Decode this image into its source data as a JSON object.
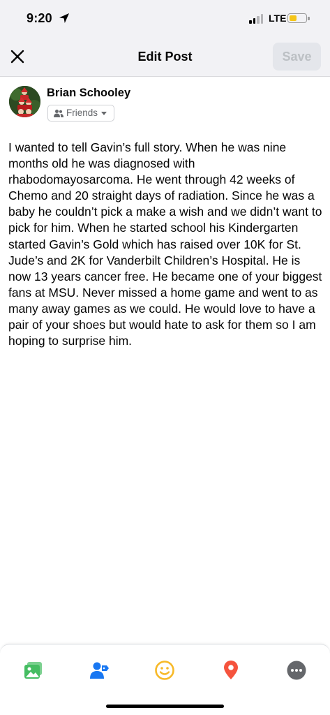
{
  "status_bar": {
    "time": "9:20",
    "network": "LTE",
    "battery_level": 0.45,
    "battery_color": "#f5c518",
    "icons": [
      "location-arrow-icon",
      "signal-icon",
      "battery-icon"
    ]
  },
  "header": {
    "close_icon": "close-icon",
    "title": "Edit Post",
    "save_label": "Save",
    "save_enabled": false
  },
  "author": {
    "name": "Brian Schooley",
    "audience_label": "Friends",
    "audience_icon": "friends-icon"
  },
  "post": {
    "text": "I wanted to tell Gavin’s full story. When he was nine months old he was diagnosed with rhabodomayosarcoma. He went through 42 weeks of Chemo and 20 straight days of radiation. Since he was a baby he couldn’t pick a make a wish and we didn’t want to pick for him. When he started school his Kindergarten started Gavin’s Gold which has raised over 10K for St. Jude’s and 2K for Vanderbilt Children’s Hospital. He is now 13 years cancer free. He became one of your biggest fans at MSU. Never missed a home game and went to as many away games as we could. He would love to have a pair of your shoes but would hate to ask for them so I am hoping to surprise him."
  },
  "toolbar": {
    "items": [
      {
        "name": "photo-icon",
        "color": "#45bd62"
      },
      {
        "name": "tag-people-icon",
        "color": "#1877f2"
      },
      {
        "name": "feeling-icon",
        "color": "#f7b928"
      },
      {
        "name": "check-in-icon",
        "color": "#f5533d"
      },
      {
        "name": "more-icon",
        "color": "#65676b"
      }
    ]
  },
  "colors": {
    "header_bg": "#f2f2f5",
    "save_disabled_bg": "#e4e6eb",
    "save_disabled_text": "#bcc0c4",
    "secondary_text": "#65676b"
  }
}
